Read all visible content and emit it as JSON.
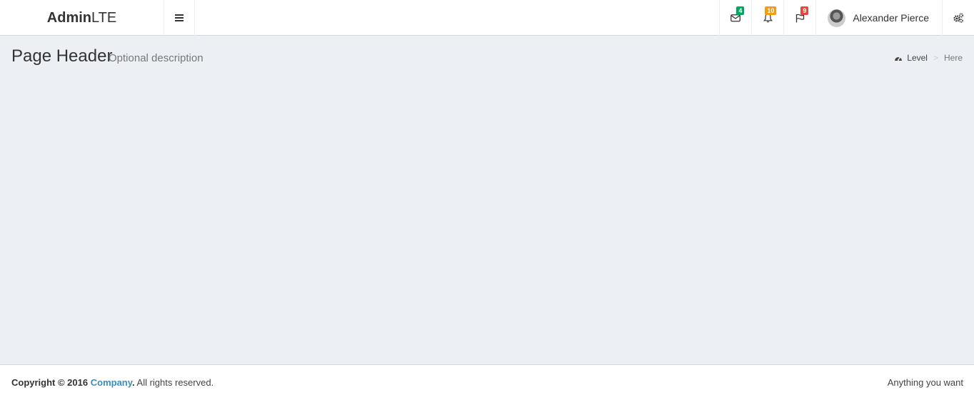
{
  "header": {
    "logo_bold": "Admin",
    "logo_light": "LTE",
    "messages": {
      "count": "4",
      "badge_color": "#00a65a",
      "icon": "envelope-icon"
    },
    "notifications": {
      "count": "10",
      "badge_color": "#f39c12",
      "icon": "bell-icon"
    },
    "tasks": {
      "count": "9",
      "badge_color": "#dd4b39",
      "icon": "flag-icon"
    },
    "user": {
      "name": "Alexander Pierce"
    },
    "settings_icon": "gears-icon"
  },
  "content_header": {
    "title": "Page Header",
    "description": "Optional description"
  },
  "breadcrumb": {
    "level": "Level",
    "separator": ">",
    "active": "Here"
  },
  "footer": {
    "copyright_prefix": "Copyright © 2016",
    "company": "Company",
    "suffix": "All rights reserved.",
    "right_text": "Anything you want"
  },
  "colors": {
    "background": "#ecf0f5",
    "link": "#3c8dbc"
  }
}
